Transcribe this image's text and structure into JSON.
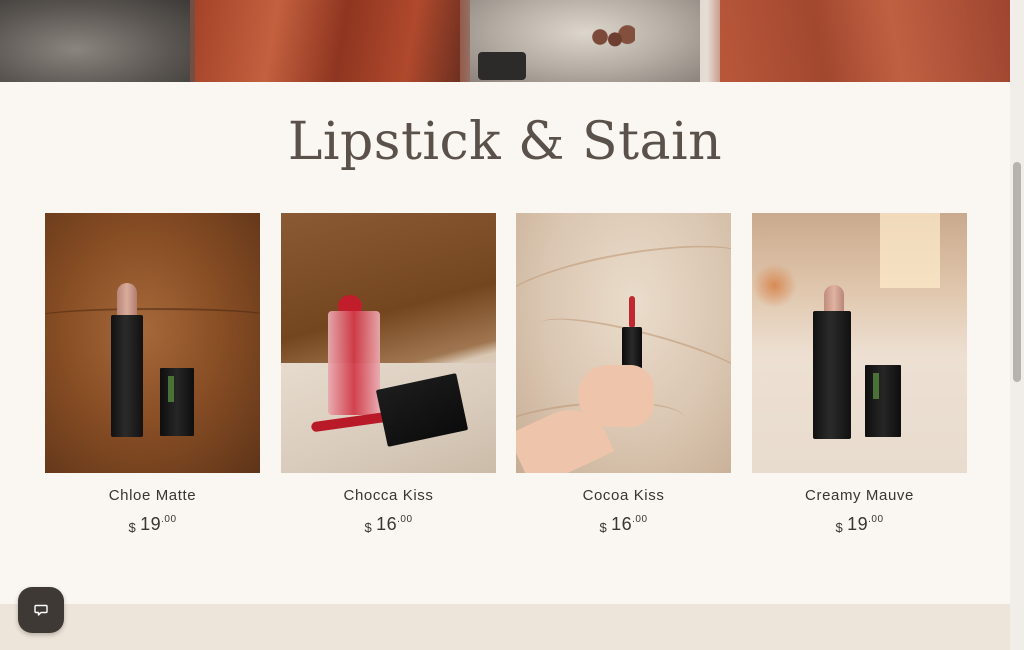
{
  "collection": {
    "title": "Lipstick & Stain",
    "products": [
      {
        "name": "Chloe Matte",
        "currency": "$",
        "price_int": "19",
        "price_cents": ".00"
      },
      {
        "name": "Chocca Kiss",
        "currency": "$",
        "price_int": "16",
        "price_cents": ".00"
      },
      {
        "name": "Cocoa Kiss",
        "currency": "$",
        "price_int": "16",
        "price_cents": ".00"
      },
      {
        "name": "Creamy Mauve",
        "currency": "$",
        "price_int": "19",
        "price_cents": ".00"
      }
    ]
  },
  "chat": {
    "icon": "chat-icon"
  },
  "colors": {
    "background": "#faf6f1",
    "title": "#5b514b",
    "chat_button": "#3f3935"
  }
}
